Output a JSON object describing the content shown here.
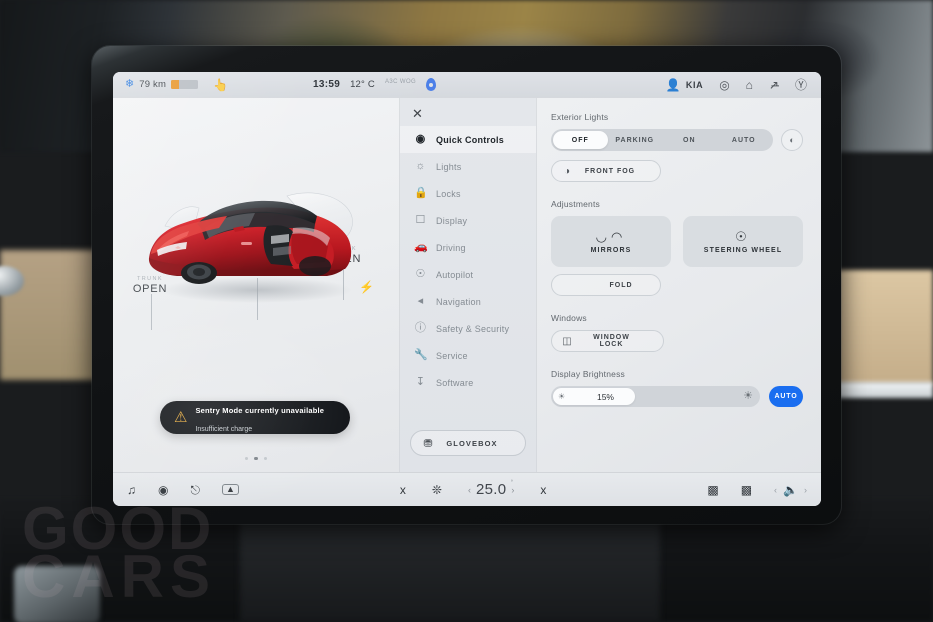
{
  "status_bar": {
    "snow_icon": "snowflake-icon",
    "range": "79 km",
    "battery_pct": 28,
    "hand_icon": "hand-brake-icon",
    "time": "13:59",
    "temperature": "12° C",
    "geo_text": "A3C WOG",
    "pin_icon": "map-pin-icon",
    "user_name": "KIA",
    "user_icon": "person-icon",
    "record_icon": "dashcam-icon",
    "home_icon": "home-icon",
    "wifi_off_icon": "wifi-off-icon",
    "bluetooth_icon": "bluetooth-icon"
  },
  "car_view": {
    "front_trunk": {
      "label": "TRUNK",
      "value": "OPEN"
    },
    "rear_trunk": {
      "label": "TRUNK",
      "value": "OPEN"
    },
    "lock_icon": "unlocked-padlock-icon",
    "charge_icon": "charge-port-icon",
    "toast": {
      "warn_icon": "warning-triangle-icon",
      "title": "Sentry Mode currently unavailable",
      "subtitle": "Insufficient charge"
    },
    "page_dots": {
      "count": 3,
      "active": 1
    }
  },
  "menu": {
    "close_icon": "close-icon",
    "items": [
      {
        "label": "Quick Controls",
        "icon": "quick-controls-icon",
        "active": true
      },
      {
        "label": "Lights",
        "icon": "lights-icon",
        "active": false
      },
      {
        "label": "Locks",
        "icon": "lock-icon",
        "active": false
      },
      {
        "label": "Display",
        "icon": "display-icon",
        "active": false
      },
      {
        "label": "Driving",
        "icon": "car-icon",
        "active": false
      },
      {
        "label": "Autopilot",
        "icon": "steering-wheel-icon",
        "active": false
      },
      {
        "label": "Navigation",
        "icon": "navigation-arrow-icon",
        "active": false
      },
      {
        "label": "Safety & Security",
        "icon": "alert-circle-icon",
        "active": false
      },
      {
        "label": "Service",
        "icon": "wrench-icon",
        "active": false
      },
      {
        "label": "Software",
        "icon": "download-icon",
        "active": false
      }
    ],
    "glovebox": {
      "label": "GLOVEBOX",
      "icon": "glovebox-icon"
    }
  },
  "controls": {
    "exterior_lights": {
      "title": "Exterior Lights",
      "options": [
        "OFF",
        "PARKING",
        "ON",
        "AUTO"
      ],
      "selected": "OFF",
      "high_beam_icon": "high-beam-icon",
      "front_fog": {
        "label": "FRONT FOG",
        "icon": "fog-light-icon"
      }
    },
    "adjustments": {
      "title": "Adjustments",
      "cards": [
        {
          "label": "MIRRORS",
          "icon": "mirrors-icon"
        },
        {
          "label": "STEERING WHEEL",
          "icon": "steering-wheel-icon"
        }
      ],
      "fold": {
        "label": "FOLD"
      }
    },
    "windows": {
      "title": "Windows",
      "window_lock": {
        "label": "WINDOW LOCK",
        "icon": "window-lock-icon"
      }
    },
    "brightness": {
      "title": "Display Brightness",
      "value": "15%",
      "percent": 15,
      "low_icon": "sun-small-icon",
      "high_icon": "sun-large-icon",
      "auto_label": "AUTO",
      "auto_color": "#1a6ef0"
    }
  },
  "bottom_bar": {
    "left": [
      {
        "icon": "media-note-icon"
      },
      {
        "icon": "camera-icon"
      },
      {
        "icon": "wiper-icon"
      },
      {
        "icon": "vent-up-icon"
      },
      {
        "icon": "seat-heater-left-icon"
      },
      {
        "icon": "fan-icon"
      }
    ],
    "temperature": {
      "prev": "‹",
      "value": "25.0",
      "unit": "°",
      "next": "›"
    },
    "right": [
      {
        "icon": "seat-heater-right-icon"
      },
      {
        "icon": "rear-defrost-icon"
      },
      {
        "icon": "front-defrost-icon"
      }
    ],
    "volume": {
      "prev": "‹",
      "icon": "volume-icon",
      "next": "›"
    }
  },
  "watermark": {
    "line1": "GOOD",
    "line2": "CARS"
  }
}
